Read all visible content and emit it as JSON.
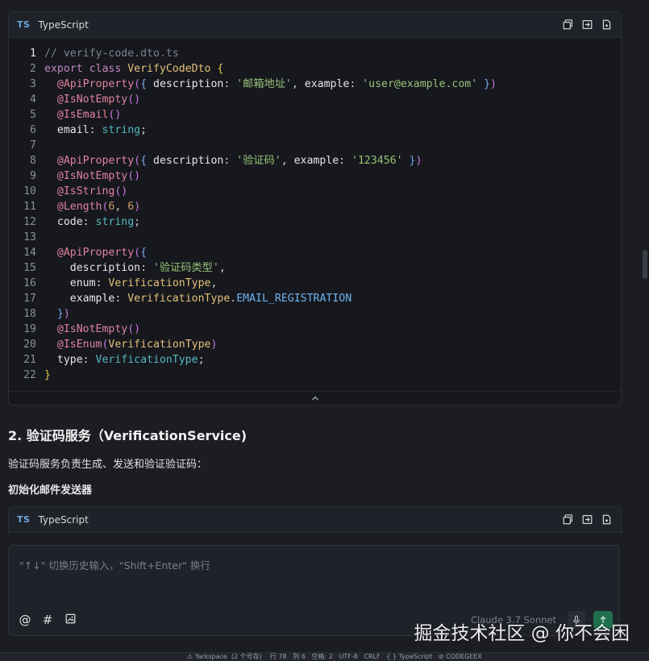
{
  "code_block_1": {
    "lang_badge": "TS",
    "lang_name": "TypeScript",
    "lines": [
      [
        [
          "t-comment",
          "// verify-code.dto.ts"
        ]
      ],
      [
        [
          "t-kw",
          "export class "
        ],
        [
          "t-cls",
          "VerifyCodeDto "
        ],
        [
          "t-brace",
          "{"
        ]
      ],
      [
        [
          "t-dec",
          "  @ApiProperty"
        ],
        [
          "t-paren",
          "("
        ],
        [
          "t-paren2",
          "{ "
        ],
        [
          "t-prop",
          "description"
        ],
        [
          "t-punc",
          ": "
        ],
        [
          "t-str",
          "'邮箱地址'"
        ],
        [
          "t-punc",
          ", "
        ],
        [
          "t-prop",
          "example"
        ],
        [
          "t-punc",
          ": "
        ],
        [
          "t-str",
          "'user@example.com'"
        ],
        [
          "t-paren2",
          " }"
        ],
        [
          "t-paren",
          ")"
        ]
      ],
      [
        [
          "t-dec",
          "  @IsNotEmpty"
        ],
        [
          "t-paren",
          "()"
        ]
      ],
      [
        [
          "t-dec",
          "  @IsEmail"
        ],
        [
          "t-paren",
          "()"
        ]
      ],
      [
        [
          "t-prop",
          "  email"
        ],
        [
          "t-punc",
          ": "
        ],
        [
          "t-type",
          "string"
        ],
        [
          "t-punc",
          ";"
        ]
      ],
      [
        [
          "t-punc",
          ""
        ]
      ],
      [
        [
          "t-dec",
          "  @ApiProperty"
        ],
        [
          "t-paren",
          "("
        ],
        [
          "t-paren2",
          "{ "
        ],
        [
          "t-prop",
          "description"
        ],
        [
          "t-punc",
          ": "
        ],
        [
          "t-str",
          "'验证码'"
        ],
        [
          "t-punc",
          ", "
        ],
        [
          "t-prop",
          "example"
        ],
        [
          "t-punc",
          ": "
        ],
        [
          "t-str",
          "'123456'"
        ],
        [
          "t-paren2",
          " }"
        ],
        [
          "t-paren",
          ")"
        ]
      ],
      [
        [
          "t-dec",
          "  @IsNotEmpty"
        ],
        [
          "t-paren",
          "()"
        ]
      ],
      [
        [
          "t-dec",
          "  @IsString"
        ],
        [
          "t-paren",
          "()"
        ]
      ],
      [
        [
          "t-dec",
          "  @Length"
        ],
        [
          "t-paren",
          "("
        ],
        [
          "t-num",
          "6"
        ],
        [
          "t-punc",
          ", "
        ],
        [
          "t-num",
          "6"
        ],
        [
          "t-paren",
          ")"
        ]
      ],
      [
        [
          "t-prop",
          "  code"
        ],
        [
          "t-punc",
          ": "
        ],
        [
          "t-type",
          "string"
        ],
        [
          "t-punc",
          ";"
        ]
      ],
      [
        [
          "t-punc",
          ""
        ]
      ],
      [
        [
          "t-dec",
          "  @ApiProperty"
        ],
        [
          "t-paren",
          "("
        ],
        [
          "t-paren2",
          "{"
        ]
      ],
      [
        [
          "t-prop",
          "    description"
        ],
        [
          "t-punc",
          ": "
        ],
        [
          "t-str",
          "'验证码类型'"
        ],
        [
          "t-punc",
          ","
        ]
      ],
      [
        [
          "t-prop",
          "    enum"
        ],
        [
          "t-punc",
          ": "
        ],
        [
          "t-cls",
          "VerificationType"
        ],
        [
          "t-punc",
          ","
        ]
      ],
      [
        [
          "t-prop",
          "    example"
        ],
        [
          "t-punc",
          ": "
        ],
        [
          "t-cls",
          "VerificationType"
        ],
        [
          "t-punc",
          "."
        ],
        [
          "t-enum",
          "EMAIL_REGISTRATION"
        ]
      ],
      [
        [
          "t-paren2",
          "  }"
        ],
        [
          "t-paren",
          ")"
        ]
      ],
      [
        [
          "t-dec",
          "  @IsNotEmpty"
        ],
        [
          "t-paren",
          "()"
        ]
      ],
      [
        [
          "t-dec",
          "  @IsEnum"
        ],
        [
          "t-paren",
          "("
        ],
        [
          "t-cls",
          "VerificationType"
        ],
        [
          "t-paren",
          ")"
        ]
      ],
      [
        [
          "t-prop",
          "  type"
        ],
        [
          "t-punc",
          ": "
        ],
        [
          "t-type",
          "VerificationType"
        ],
        [
          "t-punc",
          ";"
        ]
      ],
      [
        [
          "t-brace",
          "}"
        ]
      ]
    ]
  },
  "section": {
    "heading": "2. 验证码服务（VerificationService)",
    "paragraph": "验证码服务负责生成、发送和验证验证码：",
    "subheading": "初始化邮件发送器"
  },
  "code_block_2": {
    "lang_badge": "TS",
    "lang_name": "TypeScript"
  },
  "chat_input": {
    "placeholder": "\"↑↓\" 切换历史输入，\"Shift+Enter\" 换行",
    "tools": {
      "mention": "@",
      "hash": "#",
      "image": "🖼"
    },
    "model": "Claude 3.7 Sonnet"
  },
  "watermark": "掘金技术社区 @ 你不会困",
  "status_bar": {
    "text": "⚠ Yarkspace  (2 个号存)    行 78   列 6   空格: 2   UTF-8   CRLF   { } TypeScript   ⊘ CODEGEEX"
  },
  "colors": {
    "background": "#1b1d23",
    "card": "#16181d",
    "send_button": "#1f6f4f"
  }
}
